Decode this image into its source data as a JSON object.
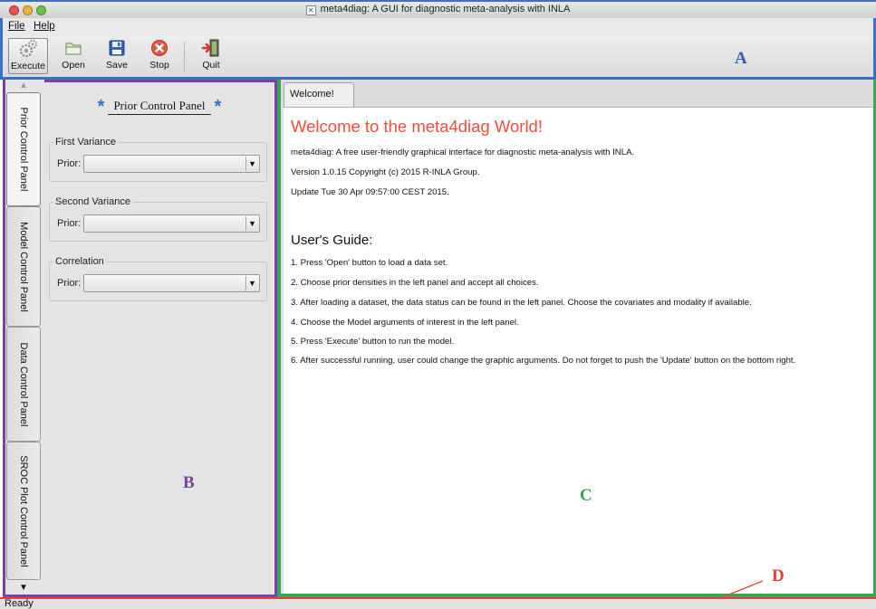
{
  "window": {
    "title": "meta4diag: A GUI for diagnostic meta-analysis with INLA"
  },
  "menu": [
    {
      "label": "File"
    },
    {
      "label": "Help"
    }
  ],
  "toolbar": {
    "execute_label": "Execute",
    "open_label": "Open",
    "save_label": "Save",
    "stop_label": "Stop",
    "quit_label": "Quit"
  },
  "annotations": {
    "a": "A",
    "b": "B",
    "c": "C",
    "d": "D"
  },
  "side_tabs": [
    {
      "label": "Prior Control Panel",
      "active": true
    },
    {
      "label": "Model Control Panel",
      "active": false
    },
    {
      "label": "Data Control Panel",
      "active": false
    },
    {
      "label": "SROC Plot Control Panel",
      "active": false
    }
  ],
  "prior_panel": {
    "title": "Prior Control Panel",
    "star": "*",
    "groups": [
      {
        "legend": "First Variance",
        "prior_label": "Prior:",
        "value": ""
      },
      {
        "legend": "Second Variance",
        "prior_label": "Prior:",
        "value": ""
      },
      {
        "legend": "Correlation",
        "prior_label": "Prior:",
        "value": ""
      }
    ]
  },
  "main": {
    "tab_label": "Welcome!",
    "heading": "Welcome to the meta4diag World!",
    "intro_lines": [
      "meta4diag: A free user-friendly graphical interface for diagnostic meta-analysis with INLA.",
      "Version 1.0.15 Copyright (c) 2015 R-INLA Group.",
      "Update Tue 30 Apr 09:57:00 CEST 2015."
    ],
    "guide_heading": "User's Guide:",
    "guide_lines": [
      "1. Press 'Open' button to load a data set.",
      "2. Choose prior densities in the left panel and accept all choices.",
      "3. After loading a dataset, the data status can be found in the left panel. Choose the covariates and modality if available.",
      "4. Choose the Model arguments of interest in the left panel.",
      "5. Press 'Execute' button to run the model.",
      "6. After successful running, user could change the graphic arguments. Do not forget to push the 'Update' button on the bottom right."
    ]
  },
  "status": {
    "text": "Ready"
  },
  "colors": {
    "region_a": "#2f5fb7",
    "region_b": "#7a3fa8",
    "region_c": "#3aa552",
    "region_d": "#e8403a",
    "welcome_heading": "#ef4e3a"
  }
}
